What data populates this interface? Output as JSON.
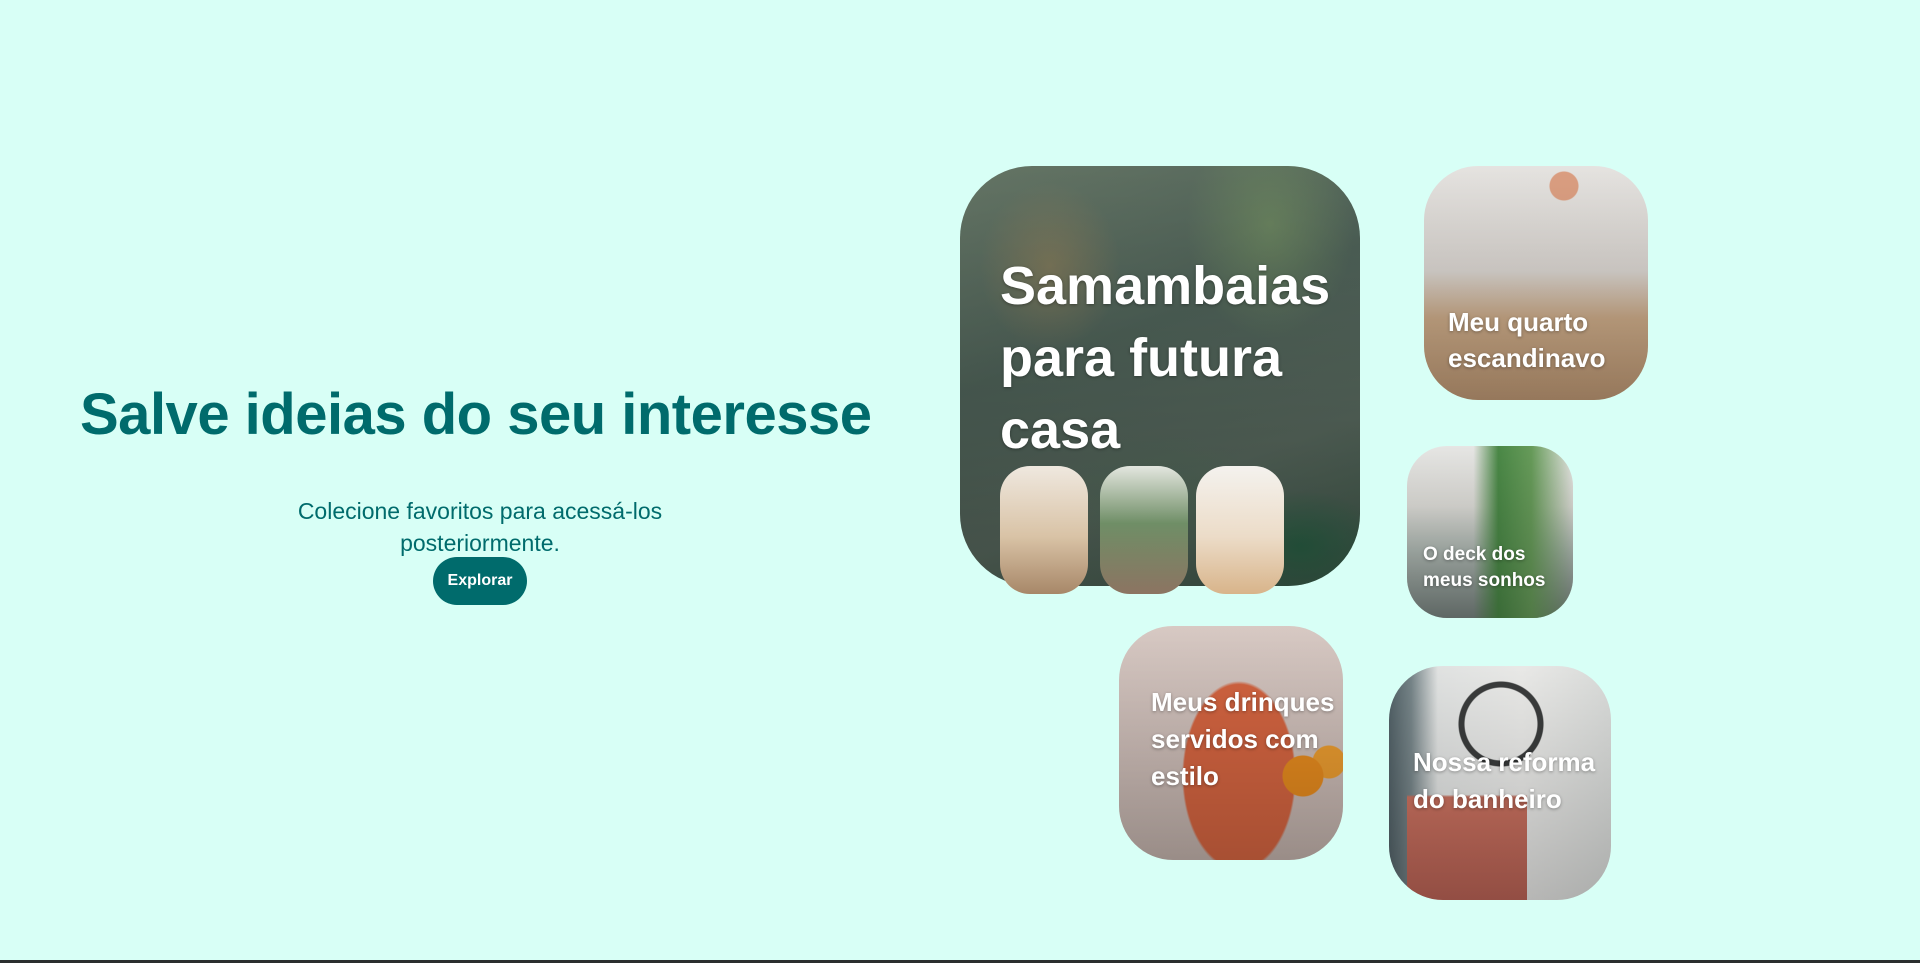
{
  "hero": {
    "title": "Salve ideias do seu interesse",
    "subtitle": "Colecione favoritos para acessá-los posteriormente.",
    "button_label": "Explorar"
  },
  "boards": [
    {
      "title": "Samambaias para futura casa"
    },
    {
      "title": "Meu quarto escandinavo"
    },
    {
      "title": "O deck dos meus sonhos"
    },
    {
      "title": "Meus drinques servidos com estilo"
    },
    {
      "title": "Nossa reforma do banheiro"
    }
  ],
  "colors": {
    "background": "#d8fff6",
    "accent": "#006b6c",
    "button_text": "#ffffff"
  }
}
